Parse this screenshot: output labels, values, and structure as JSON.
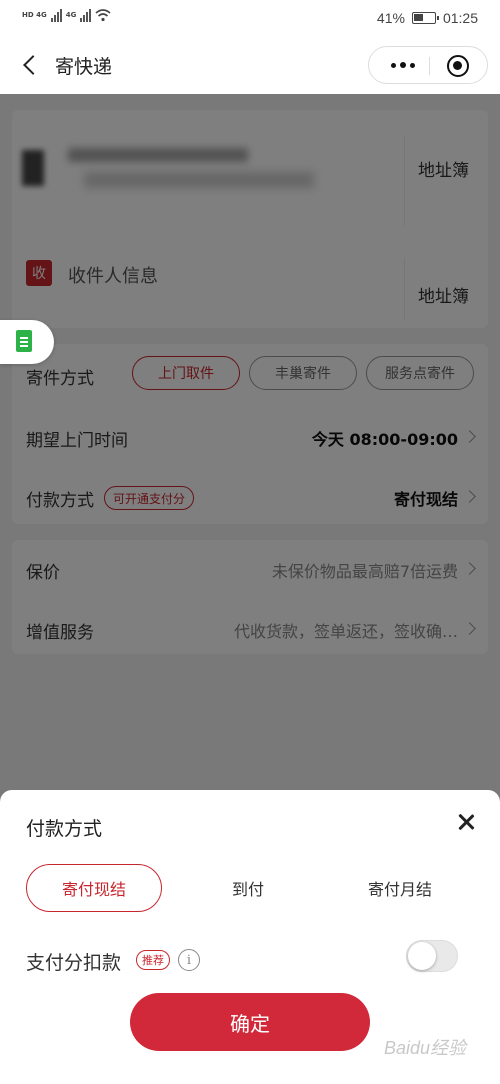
{
  "status_bar": {
    "network_left": "HD 4G",
    "network_right": "4G",
    "battery": "41%",
    "time": "01:25"
  },
  "nav": {
    "title": "寄快递"
  },
  "address": {
    "book_label": "地址簿",
    "receiver_badge": "收",
    "receiver_label": "收件人信息"
  },
  "shipping": {
    "label": "寄件方式",
    "options": [
      "上门取件",
      "丰巢寄件",
      "服务点寄件"
    ],
    "selected": "上门取件",
    "pickup_label": "期望上门时间",
    "pickup_value": "今天 08:00-09:00",
    "payment_label": "付款方式",
    "payment_tag": "可开通支付分",
    "payment_value": "寄付现结"
  },
  "extra": {
    "insurance_label": "保价",
    "insurance_value": "未保价物品最高赔7倍运费",
    "service_label": "增值服务",
    "service_value": "代收货款，签单返还，签收确…"
  },
  "sheet": {
    "title": "付款方式",
    "options": [
      "寄付现结",
      "到付",
      "寄付月结"
    ],
    "selected": "寄付现结",
    "instalment_label": "支付分扣款",
    "recommend_tag": "推荐",
    "info_symbol": "i",
    "instalment_enabled": false,
    "confirm_label": "确定"
  },
  "watermark": "Baidu经验",
  "colors": {
    "accent": "#c8262e",
    "confirm": "#d1283a",
    "doc_icon": "#2db24a"
  }
}
